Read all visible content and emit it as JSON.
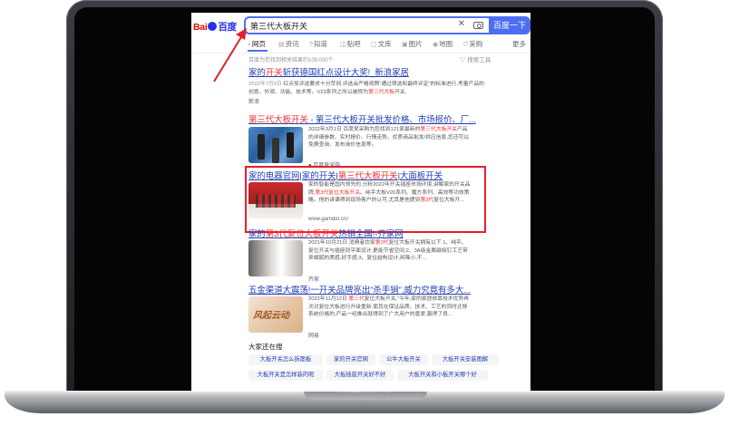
{
  "device": {
    "brand": "MacBook Pro"
  },
  "search": {
    "logo_bai": "Bai",
    "logo_du": "百度",
    "query": "第三代大板开关",
    "clear_icon": "close-icon",
    "camera_icon": "camera-icon",
    "button": "百度一下"
  },
  "tabs": [
    {
      "label": "网页",
      "icon": "search-icon"
    },
    {
      "label": "资讯",
      "icon": "news-icon"
    },
    {
      "label": "知道",
      "icon": "question-icon"
    },
    {
      "label": "贴吧",
      "icon": "forum-icon"
    },
    {
      "label": "文库",
      "icon": "doc-icon"
    },
    {
      "label": "图片",
      "icon": "image-icon"
    },
    {
      "label": "地图",
      "icon": "map-icon"
    },
    {
      "label": "采购",
      "icon": "cart-icon"
    },
    {
      "label": "更多"
    }
  ],
  "stats": "百度为您找到相关结果约109,000个",
  "tools": "搜索工具",
  "results": [
    {
      "title_a": "家的",
      "title_hl": "开关",
      "title_b": "斩获德国红点设计大奖!_新浪家居",
      "date": "2022年7月9日",
      "body_a": " 红点奖评选要求十分苛刻,评选会严格按照“通过筛选和最终评定”的标准进行,考量产品的创意、外观、功能、技术等。V23系列之所以被称为",
      "body_hl": "第三代大板",
      "body_b": "开关,",
      "source": "新浪"
    },
    {
      "title_hl": "第三代大板开关",
      "title_b": " - 第三代大板开关批发价格、市场报价、厂...",
      "body_a": "2022年3月1日 百度爱采购为您找到121家最新的",
      "body_hl": "第三代大板开关",
      "body_b": "产品的详细参数、实时报价、行情走势、优质商品批发/供应信息,您还可以免费查询、发布询价信息等。",
      "source": "百度爱采购"
    },
    {
      "title_a": "家的电器官网|家的开关|",
      "title_hl": "第三代大板开关",
      "title_b": "|大面板开关",
      "body_a": "家的智能是国内领先的,分析2022年开关插座市场环境,讲解家的开关品牌,",
      "body_hl": "第3代复位大板开关",
      "body_b": "。纯平大板V20系列、魔方系列、高效等功效策略。他的讲课得到现场客户的认可,尤其是他提到",
      "body_hl2": "第3代",
      "body_c": "复位大板开...",
      "source": "www.gamder.cn/"
    },
    {
      "title_a": "家的",
      "title_hl": "第3代复位大板开关",
      "title_b": "热销全国!-齐家网",
      "body_a": "2021年10月21日 消费者饮家",
      "body_hl": "第3代",
      "body_b": "复位大板开关拥有以下 1、纯平、复位开关与插座同平面设计,更能节省空间;2、3A级金属磁吸钉工艺带来细腻的质感,好手感;3、复位结构设计,闲降小,不...",
      "source": "齐家"
    },
    {
      "title": "五金渠道大震荡!一开关品牌亮出\"杀手锏\",威力究竟有多大...",
      "body_a": "2022年11月12日 ",
      "body_hl": "第三代",
      "body_b": "复位大板开关,“今年,家的家居依靠技术优势再次对复位大板进行升级重新,使其在保证品质、技术、工艺的同时迁移系统价格的,产品一经推出就得到了广大用户的喜爱,赢得了良...",
      "source": "网易",
      "thumb_text": "风起云动"
    }
  ],
  "related": {
    "heading": "大家还在搜",
    "items": [
      "大板开关怎么拆面板",
      "家的开关官网",
      "公牛大板开关",
      "大板开关安装图解",
      "大板开关是怎样装的呢",
      "大板插座开关好不好",
      "大板开关和小板开关哪个好"
    ]
  },
  "colors": {
    "accent": "#4e6ef2",
    "link": "#2440b3",
    "highlight": "#f73131",
    "annotation": "#e5202a"
  }
}
